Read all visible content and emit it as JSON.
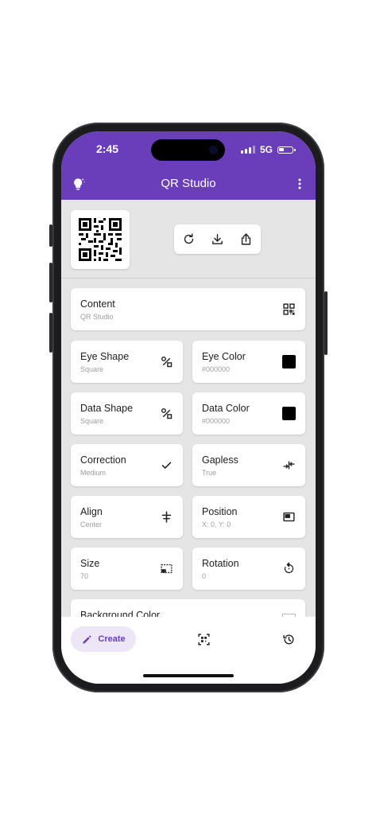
{
  "status_bar": {
    "time": "2:45",
    "network": "5G"
  },
  "app_bar": {
    "title": "QR Studio",
    "left_icon": "lightbulb-icon",
    "right_icon": "more-vert-icon"
  },
  "preview": {
    "actions": [
      "refresh-icon",
      "download-icon",
      "share-icon"
    ]
  },
  "content": {
    "label": "Content",
    "value": "QR Studio",
    "icon": "qr-code-icon"
  },
  "options": [
    {
      "label": "Eye Shape",
      "value": "Square",
      "icon": "shape-icon"
    },
    {
      "label": "Eye Color",
      "value": "#000000",
      "icon": "color-swatch-icon"
    },
    {
      "label": "Data Shape",
      "value": "Square",
      "icon": "shape-icon"
    },
    {
      "label": "Data Color",
      "value": "#000000",
      "icon": "color-swatch-icon"
    },
    {
      "label": "Correction",
      "value": "Medium",
      "icon": "check-icon"
    },
    {
      "label": "Gapless",
      "value": "True",
      "icon": "compress-icon"
    },
    {
      "label": "Align",
      "value": "Center",
      "icon": "align-center-icon"
    },
    {
      "label": "Position",
      "value": "X: 0, Y: 0",
      "icon": "picture-in-picture-icon"
    },
    {
      "label": "Size",
      "value": "70",
      "icon": "resize-icon"
    },
    {
      "label": "Rotation",
      "value": "0",
      "icon": "rotate-icon"
    }
  ],
  "background_color": {
    "label": "Background Color"
  },
  "bottom_nav": {
    "create_label": "Create",
    "items": [
      "edit-icon",
      "qr-scan-icon",
      "history-icon"
    ]
  },
  "colors": {
    "accent": "#6a3dbb",
    "pill": "#ece6f7",
    "swatch": "#000000"
  }
}
